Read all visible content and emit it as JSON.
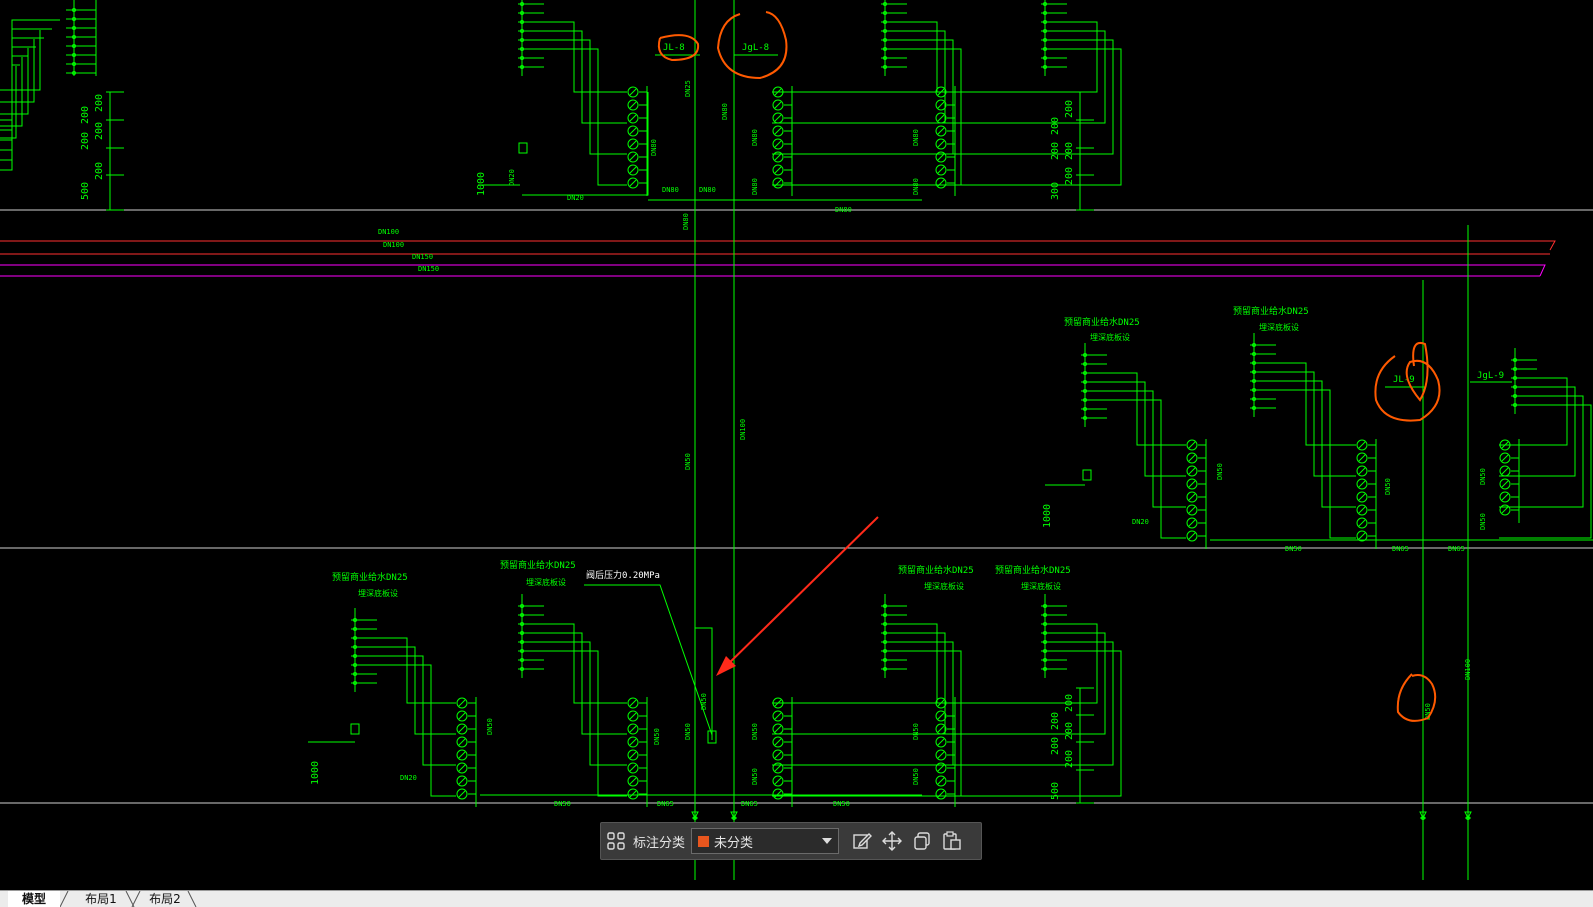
{
  "drawing": {
    "riser_labels": [
      "JL-8",
      "JgL-8",
      "JL-9",
      "JgL-9"
    ],
    "pipe_labels": [
      "DN100",
      "DN100",
      "DN150",
      "DN150",
      "DN80",
      "DN80",
      "DN80",
      "DN80",
      "DN20",
      "DN20",
      "DN20",
      "DN50",
      "DN50",
      "DN65",
      "DN65",
      "DN100"
    ],
    "reserve_label": "预留商业给水DN25",
    "reserve_sub": "埋深底板设",
    "pressure_note": "阀后压力0.20MPa",
    "elevation_1000": "1000",
    "dims": [
      "200",
      "200",
      "200",
      "200",
      "200",
      "500",
      "300"
    ]
  },
  "toolbar": {
    "category_label": "标注分类",
    "selected_category": "未分类",
    "swatch_color": "#e8561e",
    "icons": [
      "grid-icon",
      "edit-icon",
      "move-icon",
      "copy-icon",
      "paste-icon"
    ]
  },
  "tabs": [
    {
      "label": "模型",
      "active": true
    },
    {
      "label": "布局1",
      "active": false
    },
    {
      "label": "布局2",
      "active": false
    }
  ],
  "colors": {
    "pipe_green": "#00ff00",
    "main_red": "#ff3030",
    "main_magenta": "#ff00ff",
    "markup_orange": "#ff5a00",
    "arrow_red": "#ff2a1a"
  }
}
